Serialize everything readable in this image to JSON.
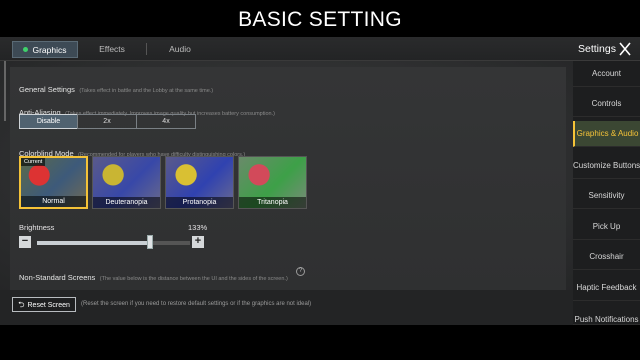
{
  "caption": "BASIC SETTING",
  "tabs": [
    {
      "label": "Graphics",
      "active": true
    },
    {
      "label": "Effects",
      "active": false
    },
    {
      "label": "Audio",
      "active": false
    }
  ],
  "header": {
    "settings_title": "Settings"
  },
  "sidebar": {
    "items": [
      {
        "label": "Account"
      },
      {
        "label": "Controls"
      },
      {
        "label": "Graphics & Audio",
        "active": true
      },
      {
        "label": "Customize Buttons"
      },
      {
        "label": "Sensitivity"
      },
      {
        "label": "Pick Up"
      },
      {
        "label": "Crosshair"
      },
      {
        "label": "Haptic Feedback"
      },
      {
        "label": "Push Notifications"
      }
    ]
  },
  "general": {
    "title": "General Settings",
    "note": "(Takes effect in battle and the Lobby at the same time.)"
  },
  "anti_aliasing": {
    "title": "Anti-Aliasing",
    "note": "(Takes effect immediately. Improves image quality but increases battery consumption.)",
    "options": [
      "Disable",
      "2x",
      "4x"
    ],
    "selected": "Disable"
  },
  "colorblind": {
    "title": "Colorblind Mode",
    "note": "(Recommended for players who have difficulty distinguishing colors.)",
    "current_badge": "Current",
    "options": [
      "Normal",
      "Deuteranopia",
      "Protanopia",
      "Tritanopia"
    ],
    "selected": "Normal"
  },
  "brightness": {
    "title": "Brightness",
    "value_text": "133%",
    "level_fraction": 0.74
  },
  "non_standard": {
    "title": "Non-Standard Screens",
    "note": "(The value below is the distance between the UI and the sides of the screen.)"
  },
  "reset": {
    "label": "Reset Screen",
    "note": "(Reset the screen if you need to restore default settings or if the graphics are not ideal)"
  },
  "colors": {
    "accent": "#f5c338",
    "active_tab_dot": "#3fd16b"
  }
}
